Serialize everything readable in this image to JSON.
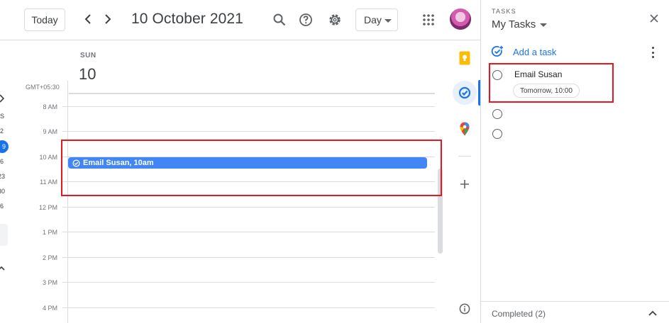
{
  "header": {
    "today_label": "Today",
    "date_title": "10 October 2021",
    "view_label": "Day"
  },
  "mini_calendar": {
    "visible_fragments": [
      "S",
      "2",
      "9",
      "6",
      "23",
      "30",
      "6"
    ],
    "selected_day": "9"
  },
  "day": {
    "weekday": "SUN",
    "number": "10",
    "timezone": "GMT+05:30",
    "hours": [
      "8 AM",
      "9 AM",
      "10 AM",
      "11 AM",
      "12 PM",
      "1 PM",
      "2 PM",
      "3 PM",
      "4 PM"
    ]
  },
  "event": {
    "title": "Email Susan, 10am",
    "color": "#4285f4"
  },
  "rail": {
    "icons": [
      "keep-icon",
      "tasks-icon",
      "maps-icon",
      "add-icon",
      "info-icon"
    ]
  },
  "tasks_panel": {
    "label": "TASKS",
    "list_name": "My Tasks",
    "add_task_label": "Add a task",
    "tasks": [
      {
        "title": "Email Susan",
        "due": "Tomorrow, 10:00"
      },
      {
        "title": "",
        "due": ""
      },
      {
        "title": "",
        "due": ""
      }
    ],
    "completed_label": "Completed (2)"
  },
  "colors": {
    "accent": "#1a73e8",
    "highlight": "#e8161e"
  }
}
